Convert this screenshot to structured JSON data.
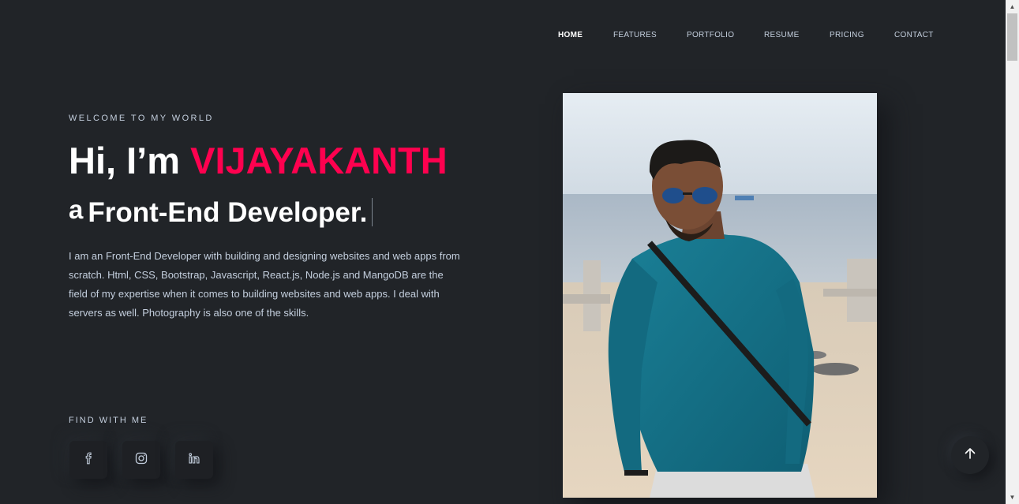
{
  "nav": {
    "items": [
      {
        "label": "HOME",
        "active": true
      },
      {
        "label": "FEATURES",
        "active": false
      },
      {
        "label": "PORTFOLIO",
        "active": false
      },
      {
        "label": "RESUME",
        "active": false
      },
      {
        "label": "PRICING",
        "active": false
      },
      {
        "label": "CONTACT",
        "active": false
      }
    ]
  },
  "hero": {
    "eyebrow": "WELCOME TO MY WORLD",
    "greeting": "Hi, I’m ",
    "name": "VIJAYAKANTH",
    "sub_prefix": "a",
    "sub_role": "Front-End Developer.",
    "bio": "I am an Front-End Developer with building and designing websites and web apps from scratch. Html, CSS, Bootstrap, Javascript, React.js, Node.js and MangoDB are the field of my expertise when it comes to building websites and web apps. I deal with servers as well. Photography is also one of the skills."
  },
  "social": {
    "label": "FIND WITH ME",
    "icons": [
      "facebook-icon",
      "instagram-icon",
      "linkedin-icon"
    ]
  },
  "colors": {
    "background": "#212428",
    "accent": "#ff014f",
    "text": "#c4cfde"
  }
}
